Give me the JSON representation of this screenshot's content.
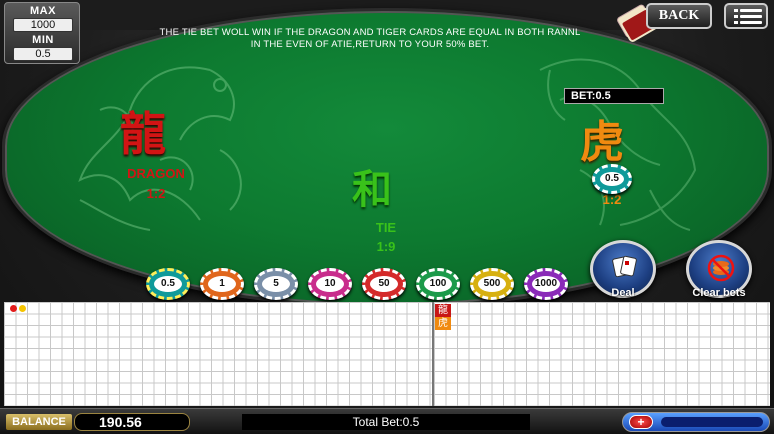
{
  "limits": {
    "max_label": "MAX",
    "max_value": "1000",
    "min_label": "MIN",
    "min_value": "0.5"
  },
  "notice": {
    "line1": "THE TIE BET WOLL WIN IF THE DRAGON AND TIGER CARDS ARE EQUAL IN BOTH RANNL",
    "line2": "IN THE EVEN OF ATIE,RETURN TO YOUR 50% BET."
  },
  "header": {
    "back_label": "BACK",
    "menu_icon": "menu-icon"
  },
  "zones": {
    "dragon": {
      "char": "龍",
      "name": "DRAGON",
      "ratio": "1:2",
      "color": "#d21414"
    },
    "tie": {
      "char": "和",
      "name": "TIE",
      "ratio": "1:9",
      "color": "#39c21a"
    },
    "tiger": {
      "char": "虎",
      "name": "TIGER",
      "ratio": "1:2",
      "color": "#f08a10"
    }
  },
  "bet_display": {
    "label": "BET:0.5",
    "placed_chip": "0.5"
  },
  "chips": [
    {
      "value": "0.5",
      "color": "#0f9a9a"
    },
    {
      "value": "1",
      "color": "#e0661c"
    },
    {
      "value": "5",
      "color": "#7a8fa8"
    },
    {
      "value": "10",
      "color": "#c82d8c"
    },
    {
      "value": "50",
      "color": "#d42a2a"
    },
    {
      "value": "100",
      "color": "#1c9a4a"
    },
    {
      "value": "500",
      "color": "#d7b010"
    },
    {
      "value": "1000",
      "color": "#8a2ab8"
    }
  ],
  "actions": {
    "deal_label": "Deal",
    "clear_label": "Clear bets"
  },
  "roadmap": {
    "marker_top": "龍",
    "marker_bottom": "虎"
  },
  "footer": {
    "balance_label": "BALANCE",
    "balance_value": "190.56",
    "total_bet": "Total Bet:0.5",
    "plus": "+"
  }
}
